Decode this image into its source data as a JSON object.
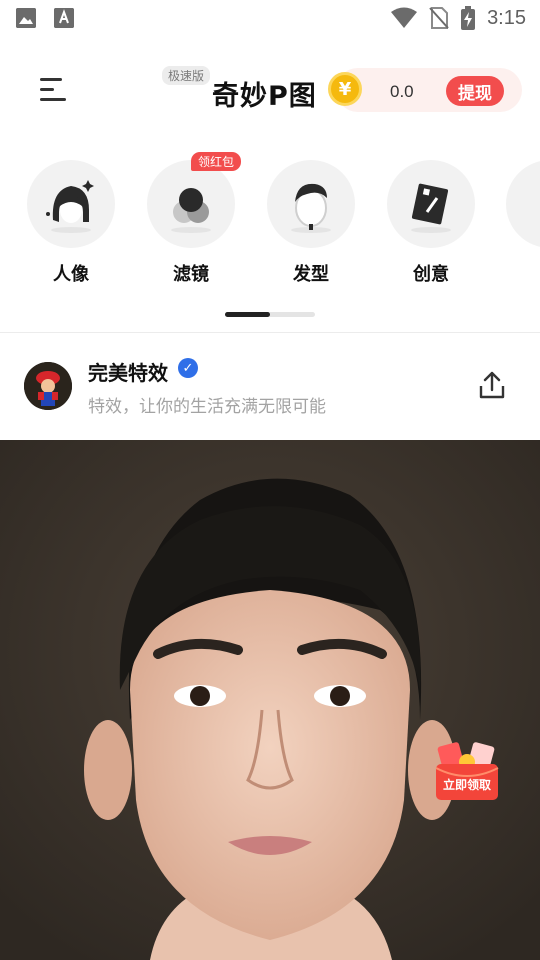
{
  "status_bar": {
    "time": "3:15",
    "left_icons": [
      "image-icon",
      "font-icon"
    ],
    "right_icons": [
      "wifi-icon",
      "no-sim-icon",
      "battery-charging-icon"
    ]
  },
  "header": {
    "badge": "极速版",
    "title": "奇妙P图",
    "coin_symbol": "¥",
    "balance": "0.0",
    "withdraw_label": "提现",
    "accent_color": "#f24d4d"
  },
  "categories": [
    {
      "label": "人像",
      "icon": "portrait-icon"
    },
    {
      "label": "滤镜",
      "icon": "filter-icon",
      "tag": "领红包"
    },
    {
      "label": "发型",
      "icon": "hairstyle-icon"
    },
    {
      "label": "创意",
      "icon": "creative-icon"
    }
  ],
  "post": {
    "title": "完美特效",
    "subtitle": "特效，让你的生活充满无限可能",
    "verified_icon": "verified-icon",
    "share_icon": "share-icon"
  },
  "floating": {
    "redpacket_label": "立即领取"
  }
}
